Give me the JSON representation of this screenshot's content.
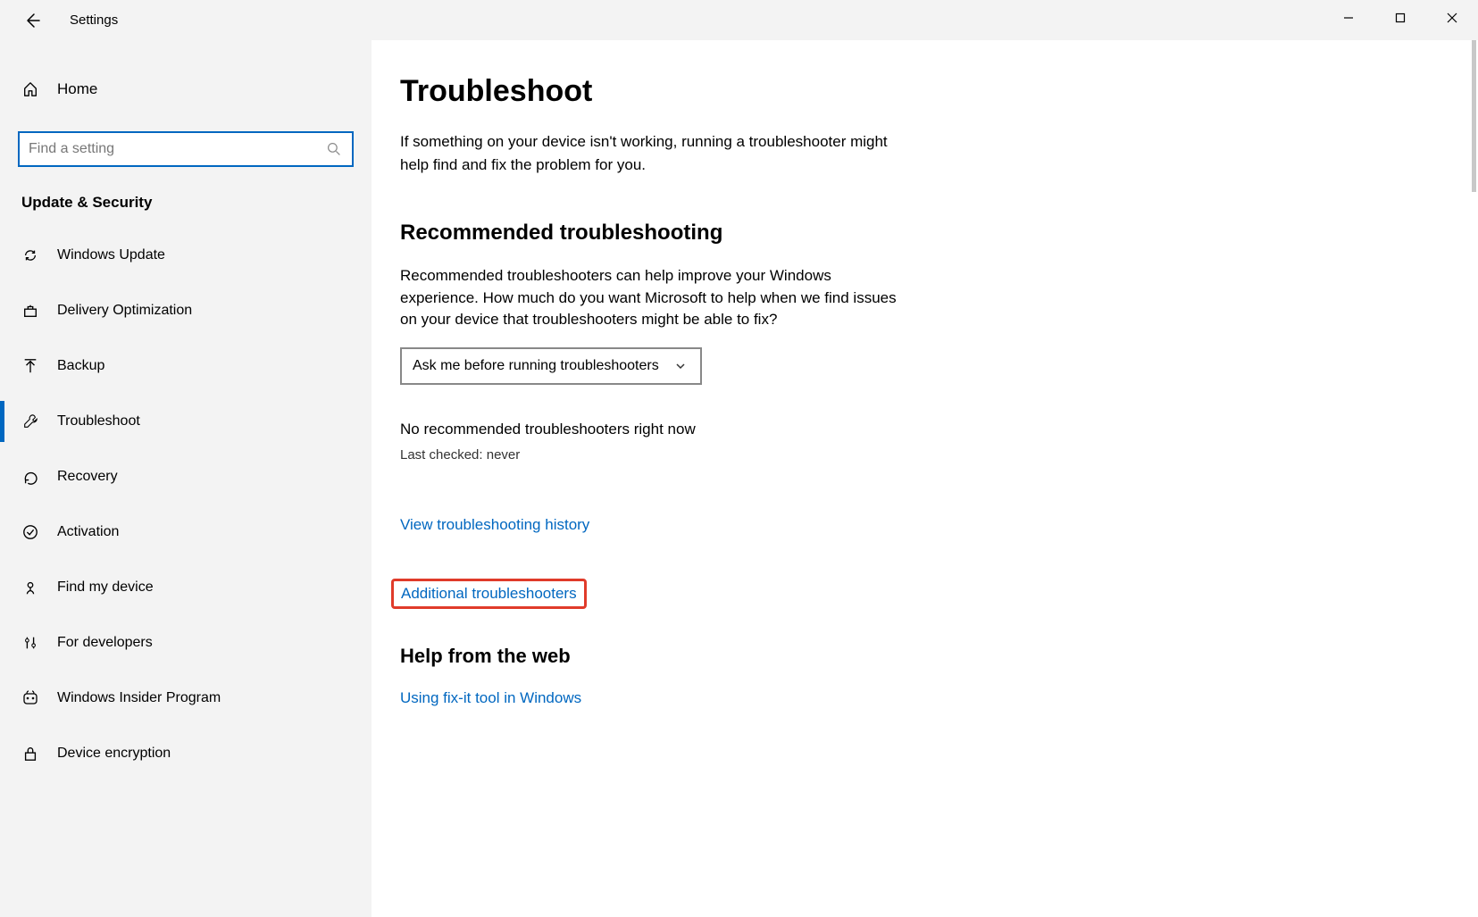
{
  "window": {
    "title": "Settings"
  },
  "sidebar": {
    "home_label": "Home",
    "search_placeholder": "Find a setting",
    "section_title": "Update & Security",
    "items": [
      {
        "label": "Windows Update"
      },
      {
        "label": "Delivery Optimization"
      },
      {
        "label": "Backup"
      },
      {
        "label": "Troubleshoot"
      },
      {
        "label": "Recovery"
      },
      {
        "label": "Activation"
      },
      {
        "label": "Find my device"
      },
      {
        "label": "For developers"
      },
      {
        "label": "Windows Insider Program"
      },
      {
        "label": "Device encryption"
      }
    ]
  },
  "main": {
    "title": "Troubleshoot",
    "intro": "If something on your device isn't working, running a troubleshooter might help find and fix the problem for you.",
    "recommended_heading": "Recommended troubleshooting",
    "recommended_desc": "Recommended troubleshooters can help improve your Windows experience. How much do you want Microsoft to help when we find issues on your device that troubleshooters might be able to fix?",
    "dropdown_value": "Ask me before running troubleshooters",
    "status_text": "No recommended troubleshooters right now",
    "last_checked": "Last checked: never",
    "history_link": "View troubleshooting history",
    "additional_link": "Additional troubleshooters",
    "help_heading": "Help from the web",
    "help_link": "Using fix-it tool in Windows"
  }
}
